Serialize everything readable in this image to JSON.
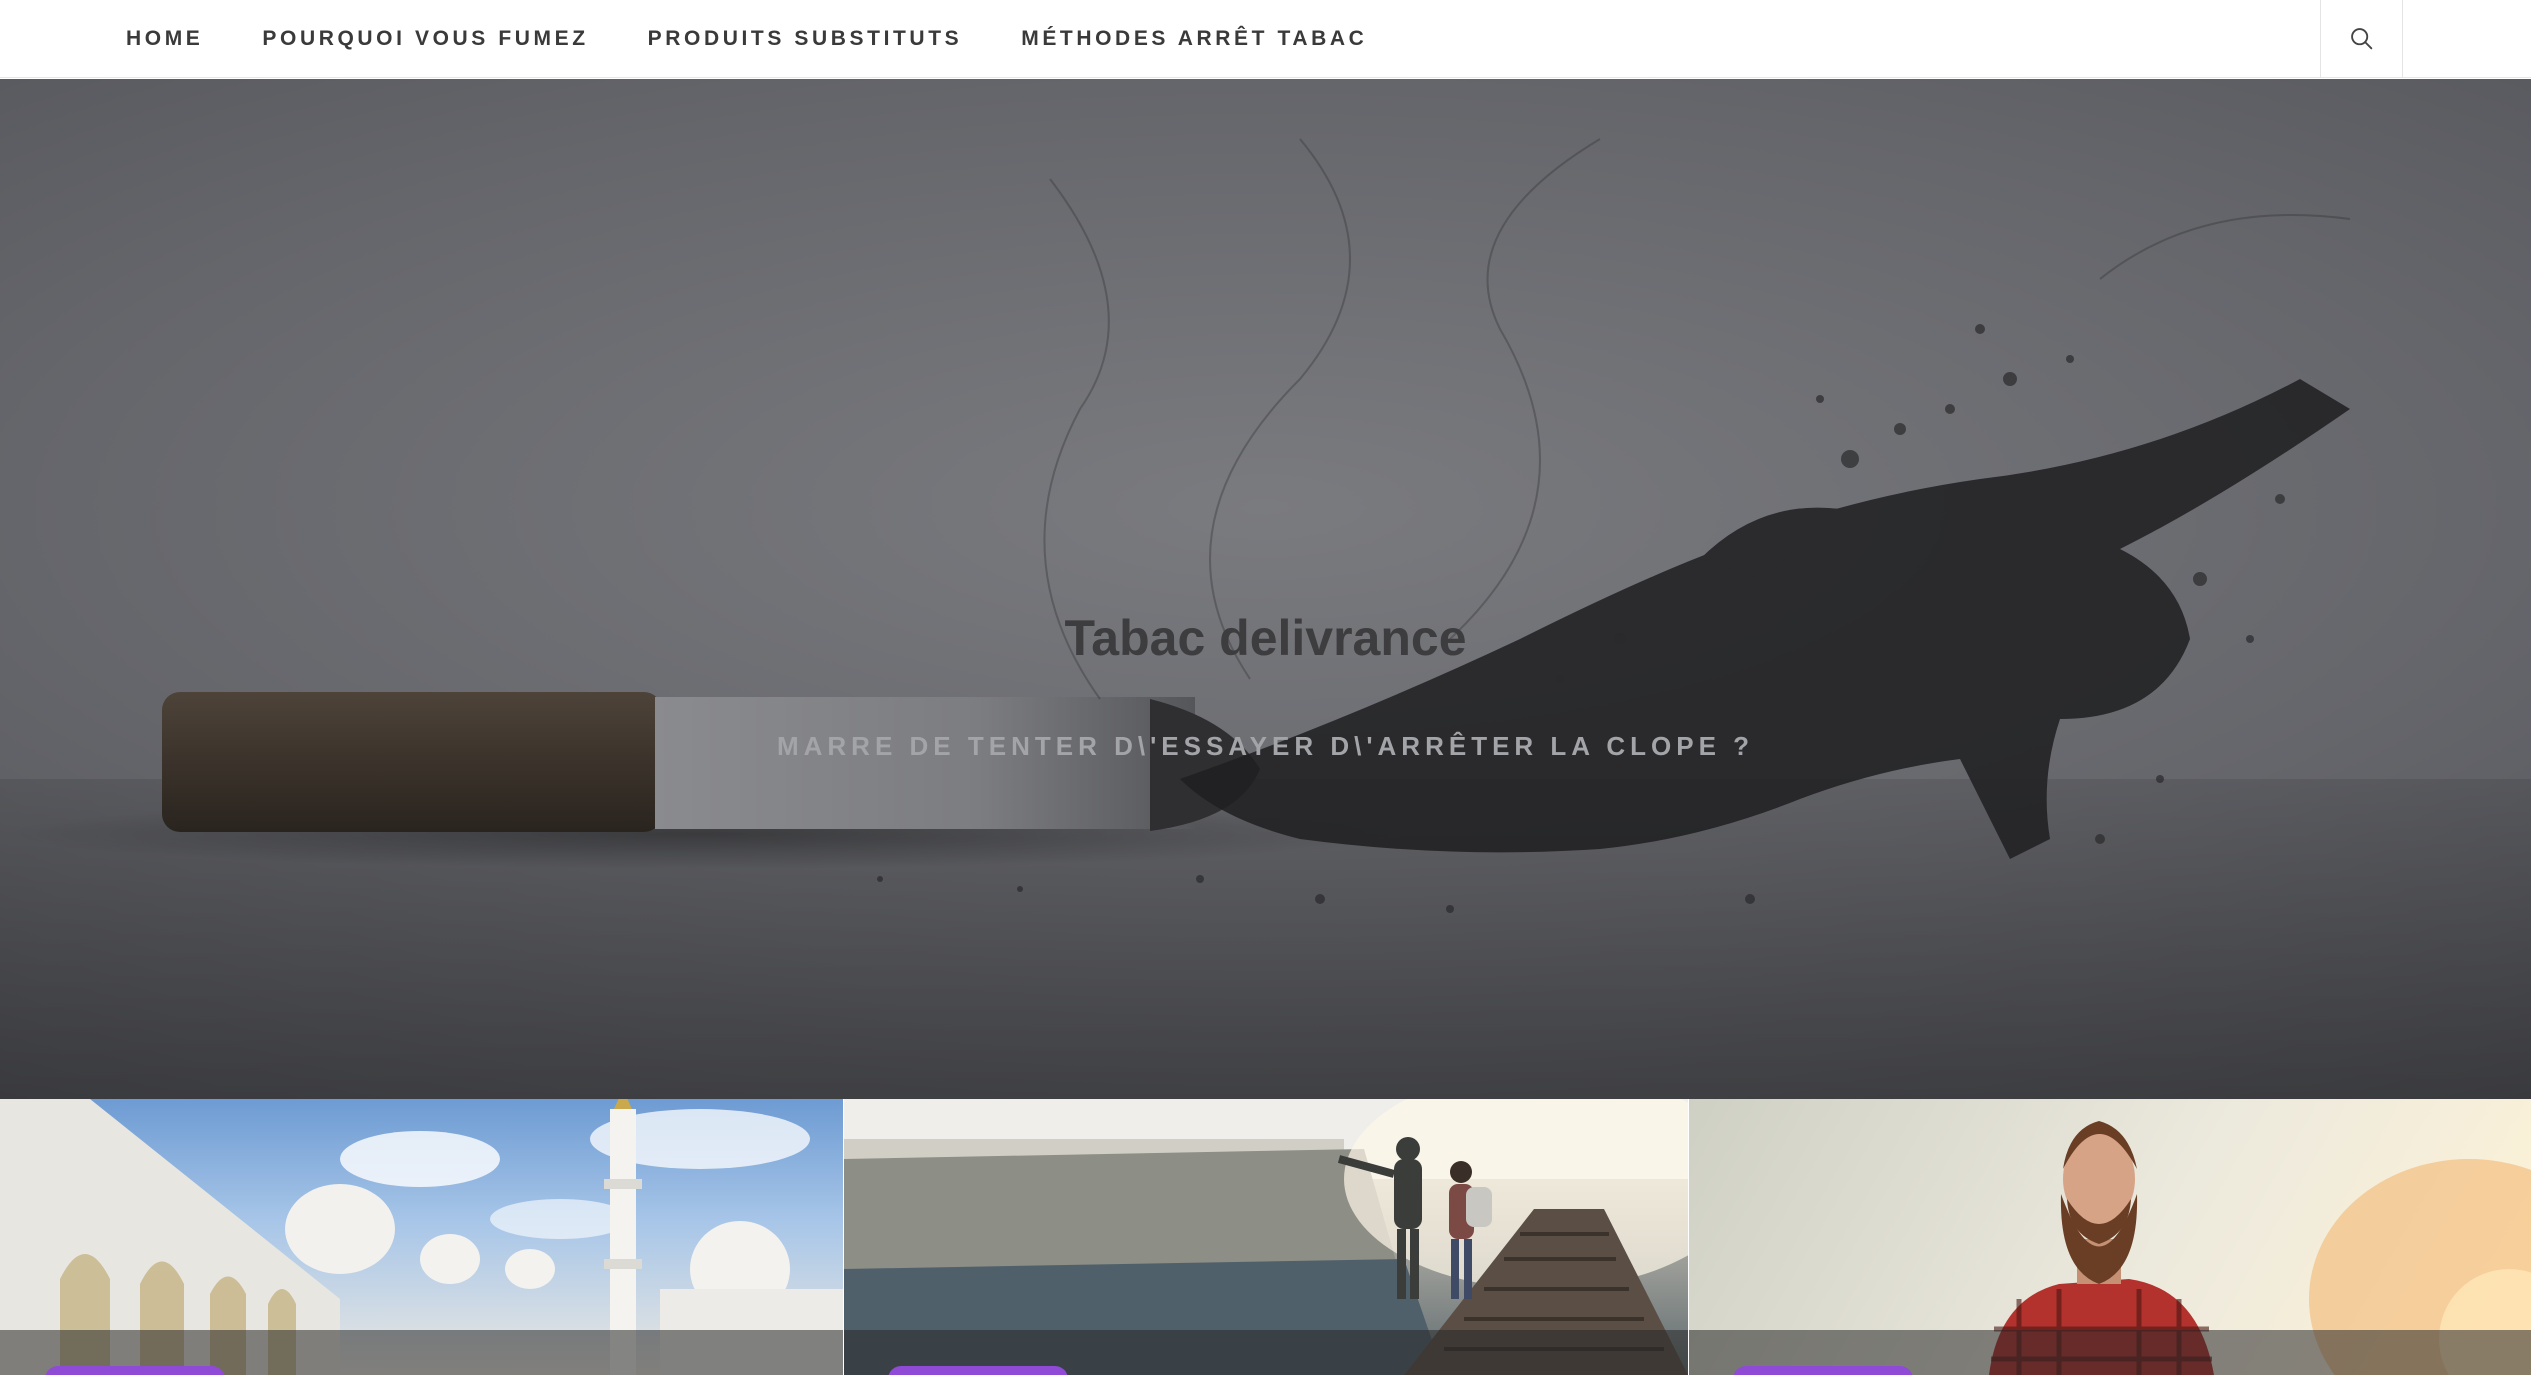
{
  "nav": {
    "items": [
      {
        "label": "HOME"
      },
      {
        "label": "POURQUOI VOUS FUMEZ"
      },
      {
        "label": "PRODUITS SUBSTITUTS"
      },
      {
        "label": "MÉTHODES ARRÊT TABAC"
      }
    ],
    "search_icon": "search-icon"
  },
  "hero": {
    "title": "Tabac delivrance",
    "subtitle": "MARRE DE TENTER D\\'ESSAYER D\\'ARRÊTER LA CLOPE ?"
  },
  "cards": [
    {
      "image": "mosque"
    },
    {
      "image": "couple-walking-on-railway-bridge"
    },
    {
      "image": "bearded-man-plaid-shirt"
    }
  ],
  "colors": {
    "nav_text": "#3a3a3a",
    "hero_title": "#3d3d3f",
    "hero_subtitle": "#a3a4a8",
    "badge": "#8f4ad6"
  }
}
